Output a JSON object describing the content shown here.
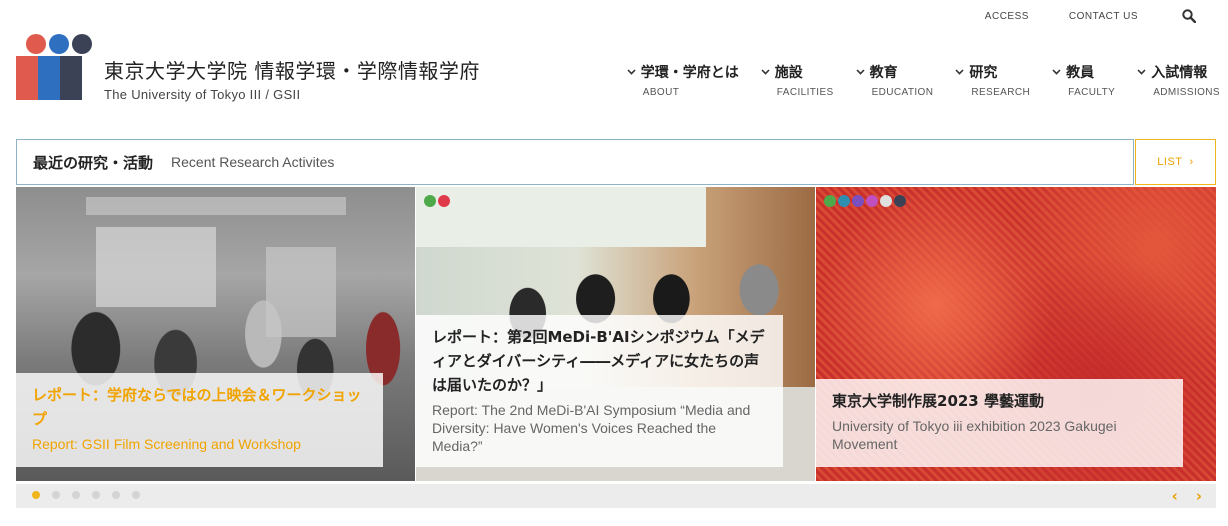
{
  "utility": {
    "access": "ACCESS",
    "contact": "CONTACT US",
    "search_icon": "search-icon"
  },
  "brand": {
    "title_jp": "東京大学大学院 情報学環・学際情報学府",
    "title_en": "The University of Tokyo III / GSII",
    "colors": {
      "red": "#e05a4e",
      "blue": "#2f6fc0",
      "navy": "#3c4256"
    }
  },
  "nav": [
    {
      "jp": "学環・学府とは",
      "en": "ABOUT"
    },
    {
      "jp": "施設",
      "en": "FACILITIES"
    },
    {
      "jp": "教育",
      "en": "EDUCATION"
    },
    {
      "jp": "研究",
      "en": "RESEARCH"
    },
    {
      "jp": "教員",
      "en": "FACULTY"
    },
    {
      "jp": "入試情報",
      "en": "ADMISSIONS"
    }
  ],
  "section": {
    "title_jp": "最近の研究・活動",
    "title_en": "Recent Research Activites",
    "list_label": "LIST",
    "list_arrow": "›"
  },
  "slides": [
    {
      "title_jp": "レポート：学府ならではの上映会＆ワークショップ",
      "title_en": "Report: GSII Film Screening and Workshop",
      "accent": "#f1a300"
    },
    {
      "title_jp": "レポート：第2回MeDi-B'AIシンポジウム「メディアとダイバーシティ――メディアに女たちの声は届いたのか？」",
      "title_en": "Report: The 2nd MeDi-B'AI Symposium “Media and Diversity: Have Women's Voices Reached the Media?”",
      "accent": "#222222"
    },
    {
      "title_jp": "東京大学制作展2023 學藝運動",
      "title_en": "University of Tokyo iii exhibition 2023 Gakugei Movement",
      "accent": "#222222"
    }
  ],
  "pager": {
    "count": 6,
    "active": 0,
    "prev": "‹",
    "next": "›",
    "active_color": "#f1b51c"
  }
}
